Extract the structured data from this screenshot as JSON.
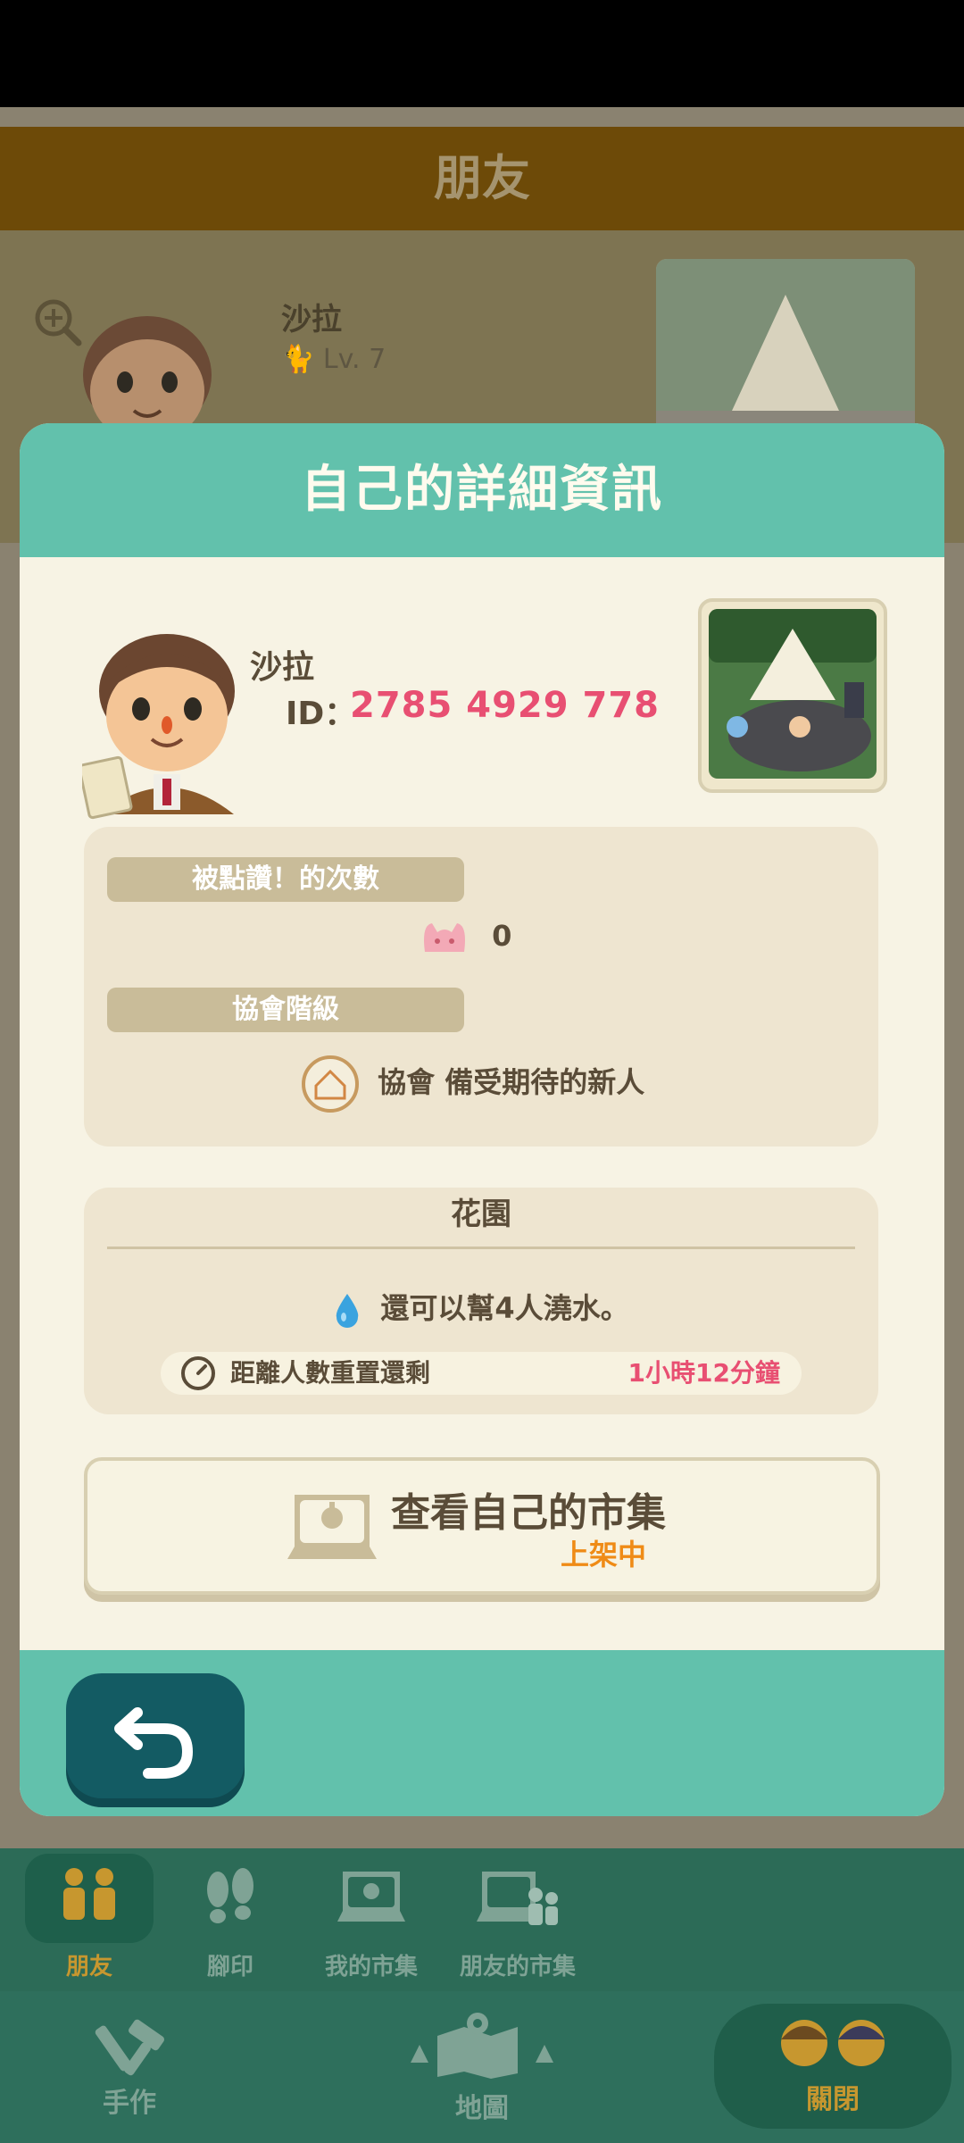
{
  "background": {
    "header_title": "朋友",
    "friend": {
      "name": "沙拉",
      "level": "Lv. 7"
    }
  },
  "modal": {
    "title": "自己的詳細資訊",
    "profile": {
      "name": "沙拉",
      "id_label": "ID：",
      "id_value": "2785 4929 778"
    },
    "likes": {
      "label": "被點讚！的次數",
      "count": "0"
    },
    "rank": {
      "label": "協會階級",
      "value": "協會 備受期待的新人"
    },
    "garden": {
      "title": "花園",
      "water_text": "還可以幫4人澆水。",
      "reset_label": "距離人數重置還剩",
      "reset_value": "1小時12分鐘"
    },
    "market_button": {
      "title": "查看自己的市集",
      "status": "上架中"
    }
  },
  "nav": {
    "tabs": [
      "朋友",
      "腳印",
      "我的市集",
      "朋友的市集"
    ],
    "bottom": [
      "手作",
      "地圖",
      "關閉"
    ]
  },
  "colors": {
    "accent": "#62c1ac",
    "id_pink": "#e84f72",
    "status_orange": "#ef8b16",
    "back_button": "#135b63"
  }
}
